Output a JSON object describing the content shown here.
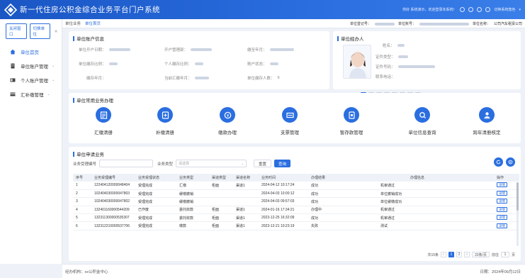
{
  "app": {
    "title": "新一代住房公积金综合业务平台门户系统"
  },
  "topbar": {
    "greeting": "你好 系统演示，欢迎登录本系统！",
    "extra_label": "切换系统角色"
  },
  "sidebar": {
    "close_window": "关闭窗口",
    "switch_unit": "切换单位",
    "items": [
      {
        "label": "单位首页",
        "icon": "home-icon",
        "active": true
      },
      {
        "label": "单位账户管理",
        "icon": "building-icon",
        "active": false
      },
      {
        "label": "个人账户管理",
        "icon": "id-card-icon",
        "active": false
      },
      {
        "label": "汇补缴管理",
        "icon": "card-icon",
        "active": false
      }
    ]
  },
  "tabs": {
    "items": [
      {
        "label": "单位业务"
      },
      {
        "label": "单位首页"
      }
    ]
  },
  "unit_header": {
    "register_label": "单位登记号：",
    "account_label": "单位账号：",
    "name_label": "单位名称：",
    "name_value": "公司汽车租赁公司"
  },
  "account_info": {
    "title": "单位账户信息",
    "fields": [
      {
        "label": "单位开户日期："
      },
      {
        "label": "开户管理部："
      },
      {
        "label": "缴至年月："
      },
      {
        "label": "单位缴存比例："
      },
      {
        "label": "个人缴存比例："
      },
      {
        "label": "账户状态："
      },
      {
        "label": "缴存年月："
      },
      {
        "label": "当前汇缴年月："
      },
      {
        "label": "单位缴存人数："
      }
    ],
    "headcount": "9"
  },
  "operator": {
    "title": "单位经办人",
    "fields": [
      {
        "label": "姓名："
      },
      {
        "label": "证件类型："
      },
      {
        "label": "证件号码："
      },
      {
        "label": "联系电话："
      }
    ],
    "slides": 8,
    "active_slide": 0
  },
  "business": {
    "title": "单位常用业务办理",
    "items": [
      {
        "label": "汇缴清册",
        "icon": "list-icon"
      },
      {
        "label": "补缴清册",
        "icon": "plus-doc-icon"
      },
      {
        "label": "缴款办理",
        "icon": "money-icon"
      },
      {
        "label": "支票管理",
        "icon": "cheque-icon"
      },
      {
        "label": "暂存款管理",
        "icon": "deposit-icon"
      },
      {
        "label": "单位信息查询",
        "icon": "search-icon"
      },
      {
        "label": "跨年清册核定",
        "icon": "user-stamp-icon"
      }
    ]
  },
  "applications": {
    "title": "单位申请业务",
    "filter": {
      "code_label": "业务受理编号",
      "type_label": "业务类型",
      "type_placeholder": "请选择",
      "reset": "重置",
      "query": "查询"
    },
    "columns": [
      "序号",
      "业务受理编号",
      "业务受理状态",
      "业务类型",
      "渠道类型",
      "渠道名称",
      "业务时间",
      "办理结果",
      "办理信息",
      "操作"
    ],
    "rows": [
      {
        "no": "1",
        "code": "122404120000048404",
        "status": "受理完成",
        "type": "汇缴",
        "channel_type": "柜面",
        "channel": "渠道1",
        "time": "2024-04-12 10:17:24",
        "result": "成功",
        "info": "机审通过",
        "op": "详情"
      },
      {
        "no": "2",
        "code": "102404030000047803",
        "status": "受理完成",
        "type": "缓缴撤销",
        "channel_type": "",
        "channel": "",
        "time": "2024-04-03 10:00:12",
        "result": "成功",
        "info": "单位撤销成功",
        "op": "详情"
      },
      {
        "no": "3",
        "code": "102404030000047802",
        "status": "受理完成",
        "type": "缓缴撤销",
        "channel_type": "",
        "channel": "",
        "time": "2024-04-03 09:57:03",
        "result": "成功",
        "info": "单位缓缴成功",
        "op": "详情"
      },
      {
        "no": "4",
        "code": "132401160000544209",
        "status": "已作废",
        "type": "委托收款",
        "channel_type": "柜面",
        "channel": "渠道1",
        "time": "2024-01-16 17:34:21",
        "result": "办理中",
        "info": "机审通过",
        "op": "详情"
      },
      {
        "no": "5",
        "code": "132311300000535307",
        "status": "受理完成",
        "type": "委托收款",
        "channel_type": "柜面",
        "channel": "渠道1",
        "time": "2023-12-25 16:32:09",
        "result": "成功",
        "info": "机审通过",
        "op": "详情"
      },
      {
        "no": "6",
        "code": "132312210000537706",
        "status": "受理完成",
        "type": "缴款",
        "channel_type": "柜面",
        "channel": "渠道1",
        "time": "2023-12-21 10:23:19",
        "result": "失败",
        "info": "测试",
        "op": "详情"
      }
    ],
    "pager": {
      "total": "共15条",
      "current": "1",
      "next": "2",
      "page_size": "20条/页",
      "goto_prefix": "前往",
      "goto_value": "1",
      "goto_suffix": "页"
    }
  },
  "footer": {
    "org": "经办机构：xx公积金中心",
    "date": "日期：2024年09月12日"
  },
  "colors": {
    "primary": "#2a6ee0",
    "topbar": "#1a56c4"
  }
}
